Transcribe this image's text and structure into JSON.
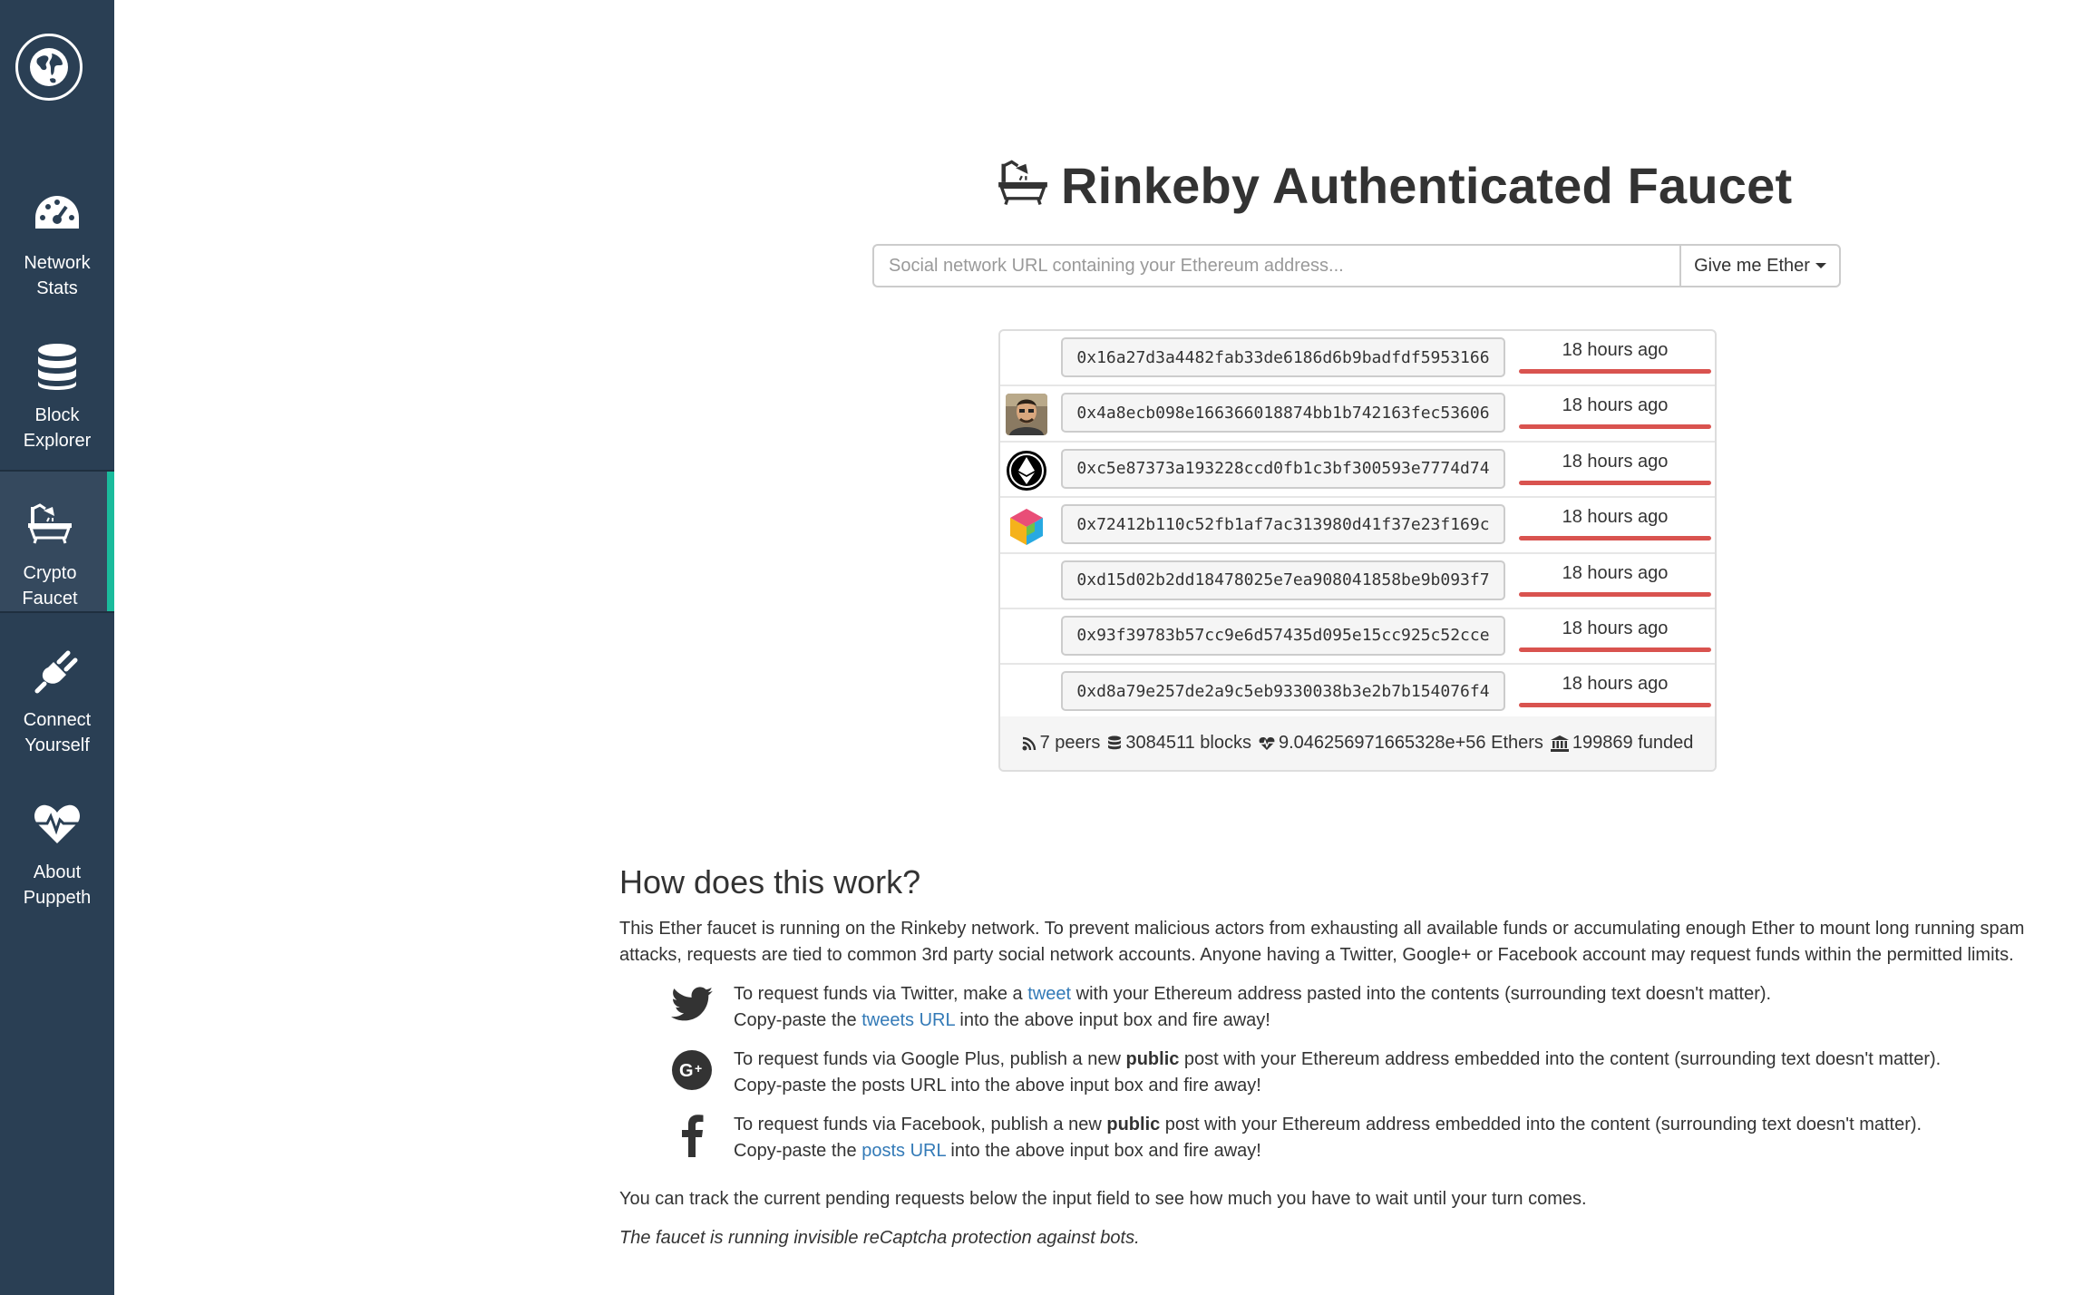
{
  "sidebar": {
    "logo_icon": "globe-icon",
    "items": [
      {
        "label": "Network\nStats",
        "icon": "dashboard-icon"
      },
      {
        "label": "Block\nExplorer",
        "icon": "database-icon"
      },
      {
        "label": "Crypto\nFaucet",
        "icon": "bath-icon",
        "active": true
      },
      {
        "label": "Connect\nYourself",
        "icon": "plug-icon"
      },
      {
        "label": "About\nPuppeth",
        "icon": "heartbeat-icon"
      }
    ],
    "accent_color": "#1abb9c",
    "background_color": "#2a3f54"
  },
  "header": {
    "title": "Rinkeby Authenticated Faucet",
    "title_icon": "bath-icon"
  },
  "request_form": {
    "placeholder": "Social network URL containing your Ethereum address...",
    "button_label": "Give me Ether"
  },
  "requests": [
    {
      "avatar": "none",
      "address": "0x16a27d3a4482fab33de6186d6b9badfdf5953166",
      "time": "18 hours ago"
    },
    {
      "avatar": "photo",
      "address": "0x4a8ecb098e166366018874bb1b742163fec53606",
      "time": "18 hours ago"
    },
    {
      "avatar": "ethereum-logo",
      "address": "0xc5e87373a193228ccd0fb1c3bf300593e7774d74",
      "time": "18 hours ago"
    },
    {
      "avatar": "cube-logo",
      "address": "0x72412b110c52fb1af7ac313980d41f37e23f169c",
      "time": "18 hours ago"
    },
    {
      "avatar": "none",
      "address": "0xd15d02b2dd18478025e7ea908041858be9b093f7",
      "time": "18 hours ago"
    },
    {
      "avatar": "none",
      "address": "0x93f39783b57cc9e6d57435d095e15cc925c52cce",
      "time": "18 hours ago"
    },
    {
      "avatar": "none",
      "address": "0xd8a79e257de2a9c5eb9330038b3e2b7b154076f4",
      "time": "18 hours ago"
    }
  ],
  "progress_color": "#d9534f",
  "stats": {
    "peers": "7 peers",
    "blocks": "3084511 blocks",
    "ethers": "9.046256971665328e+56 Ethers",
    "funded": "199869 funded"
  },
  "how": {
    "heading": "How does this work?",
    "intro": "This Ether faucet is running on the Rinkeby network. To prevent malicious actors from exhausting all available funds or accumulating enough Ether to mount long running spam attacks, requests are tied to common 3rd party social network accounts. Anyone having a Twitter, Google+ or Facebook account may request funds within the permitted limits.",
    "twitter": {
      "l1_a": "To request funds via Twitter, make a ",
      "l1_link": "tweet",
      "l1_b": " with your Ethereum address pasted into the contents (surrounding text doesn't matter).",
      "l2_a": "Copy-paste the ",
      "l2_link": "tweets URL",
      "l2_b": " into the above input box and fire away!"
    },
    "google": {
      "l1_a": "To request funds via Google Plus, publish a new ",
      "l1_bold": "public",
      "l1_b": " post with your Ethereum address embedded into the content (surrounding text doesn't matter).",
      "l2": "Copy-paste the posts URL into the above input box and fire away!"
    },
    "facebook": {
      "l1_a": "To request funds via Facebook, publish a new ",
      "l1_bold": "public",
      "l1_b": " post with your Ethereum address embedded into the content (surrounding text doesn't matter).",
      "l2_a": "Copy-paste the ",
      "l2_link": "posts URL",
      "l2_b": " into the above input box and fire away!"
    },
    "track": "You can track the current pending requests below the input field to see how much you have to wait until your turn comes.",
    "captcha": "The faucet is running invisible reCaptcha protection against bots."
  }
}
